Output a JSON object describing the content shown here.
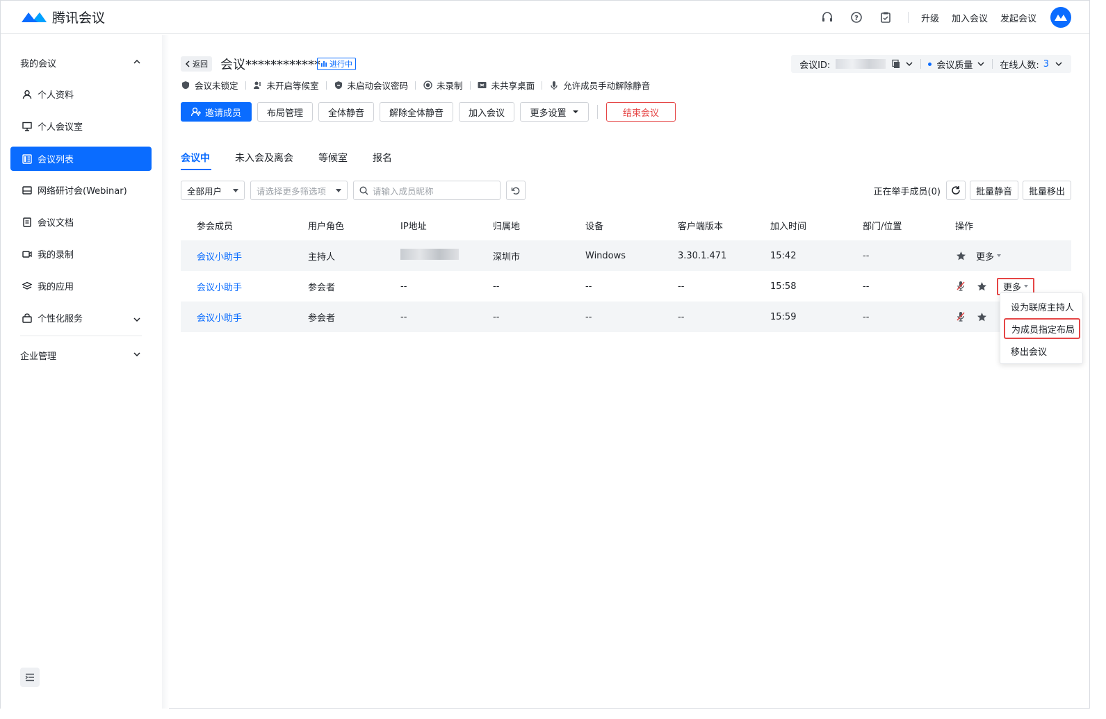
{
  "app": {
    "name": "腾讯会议"
  },
  "header": {
    "upgrade": "升级",
    "join": "加入会议",
    "start": "发起会议"
  },
  "sidebar": {
    "group_my": "我的会议",
    "items": [
      {
        "label": "个人资料",
        "icon": "user-icon"
      },
      {
        "label": "个人会议室",
        "icon": "monitor-icon"
      },
      {
        "label": "会议列表",
        "icon": "list-icon"
      },
      {
        "label": "网络研讨会(Webinar)",
        "icon": "webinar-icon"
      },
      {
        "label": "会议文档",
        "icon": "doc-icon"
      },
      {
        "label": "我的录制",
        "icon": "record-icon"
      },
      {
        "label": "我的应用",
        "icon": "apps-icon"
      },
      {
        "label": "个性化服务",
        "icon": "service-icon"
      }
    ],
    "group_enterprise": "企业管理"
  },
  "meeting": {
    "back": "返回",
    "title": "会议************",
    "status": "进行中",
    "id_label": "会议ID:",
    "quality": "会议质量",
    "online_label": "在线人数:",
    "online_count": "3"
  },
  "flags": [
    "会议未锁定",
    "未开启等候室",
    "未启动会议密码",
    "未录制",
    "未共享桌面",
    "允许成员手动解除静音"
  ],
  "actions": {
    "invite": "邀请成员",
    "layout": "布局管理",
    "mute_all": "全体静音",
    "unmute_all": "解除全体静音",
    "join": "加入会议",
    "more": "更多设置",
    "end": "结束会议"
  },
  "tabs": [
    "会议中",
    "未入会及离会",
    "等候室",
    "报名"
  ],
  "filters": {
    "user_type": "全部用户",
    "more_placeholder": "请选择更多筛选项",
    "search_placeholder": "请输入成员昵称",
    "raising": "正在举手成员(0)",
    "batch_mute": "批量静音",
    "batch_remove": "批量移出"
  },
  "table": {
    "headers": [
      "参会成员",
      "用户角色",
      "IP地址",
      "归属地",
      "设备",
      "客户端版本",
      "加入时间",
      "部门/位置",
      "操作"
    ],
    "rows": [
      {
        "name": "会议小助手",
        "role": "主持人",
        "ip": "",
        "loc": "深圳市",
        "device": "Windows",
        "version": "3.30.1.471",
        "time": "15:42",
        "dept": "--"
      },
      {
        "name": "会议小助手",
        "role": "参会者",
        "ip": "--",
        "loc": "--",
        "device": "--",
        "version": "--",
        "time": "15:58",
        "dept": "--"
      },
      {
        "name": "会议小助手",
        "role": "参会者",
        "ip": "--",
        "loc": "--",
        "device": "--",
        "version": "--",
        "time": "15:59",
        "dept": "--"
      }
    ],
    "more": "更多"
  },
  "dropdown": [
    "设为联席主持人",
    "为成员指定布局",
    "移出会议"
  ]
}
